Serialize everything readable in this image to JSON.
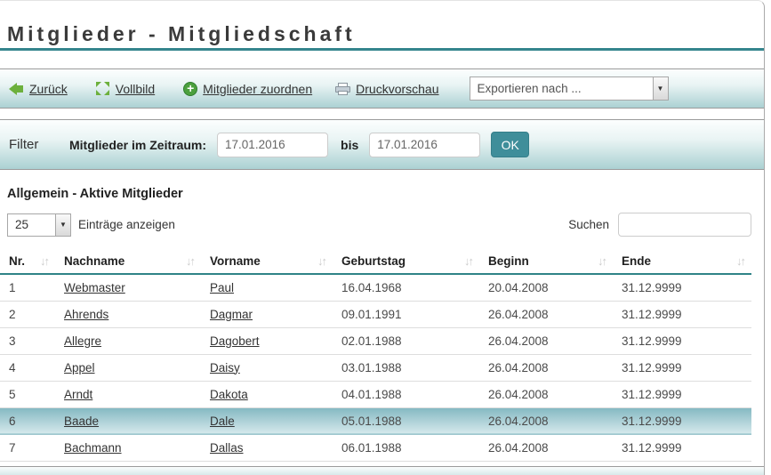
{
  "page": {
    "title": "Mitglieder - Mitgliedschaft"
  },
  "toolbar": {
    "back_label": "Zurück",
    "fullscreen_label": "Vollbild",
    "assign_label": "Mitglieder zuordnen",
    "print_label": "Druckvorschau",
    "export_selected": "Exportieren nach ...",
    "dropdown_arrow": "▼"
  },
  "filter": {
    "label": "Filter",
    "range_label": "Mitglieder im Zeitraum:",
    "date_from": "17.01.2016",
    "bis_label": "bis",
    "date_to": "17.01.2016",
    "ok_label": "OK"
  },
  "section": {
    "heading": "Allgemein - Aktive Mitglieder"
  },
  "table_controls": {
    "page_size": "25",
    "entries_label": "Einträge anzeigen",
    "search_label": "Suchen",
    "search_value": ""
  },
  "table": {
    "columns": [
      "Nr.",
      "Nachname",
      "Vorname",
      "Geburtstag",
      "Beginn",
      "Ende"
    ],
    "sort_icon": "↓↑",
    "rows": [
      {
        "nr": "1",
        "nachname": "Webmaster",
        "vorname": "Paul",
        "geburtstag": "16.04.1968",
        "beginn": "20.04.2008",
        "ende": "31.12.9999",
        "highlighted": false
      },
      {
        "nr": "2",
        "nachname": "Ahrends",
        "vorname": "Dagmar",
        "geburtstag": "09.01.1991",
        "beginn": "26.04.2008",
        "ende": "31.12.9999",
        "highlighted": false
      },
      {
        "nr": "3",
        "nachname": "Allegre",
        "vorname": "Dagobert",
        "geburtstag": "02.01.1988",
        "beginn": "26.04.2008",
        "ende": "31.12.9999",
        "highlighted": false
      },
      {
        "nr": "4",
        "nachname": "Appel",
        "vorname": "Daisy",
        "geburtstag": "03.01.1988",
        "beginn": "26.04.2008",
        "ende": "31.12.9999",
        "highlighted": false
      },
      {
        "nr": "5",
        "nachname": "Arndt",
        "vorname": "Dakota",
        "geburtstag": "04.01.1988",
        "beginn": "26.04.2008",
        "ende": "31.12.9999",
        "highlighted": false
      },
      {
        "nr": "6",
        "nachname": "Baade",
        "vorname": "Dale",
        "geburtstag": "05.01.1988",
        "beginn": "26.04.2008",
        "ende": "31.12.9999",
        "highlighted": true
      },
      {
        "nr": "7",
        "nachname": "Bachmann",
        "vorname": "Dallas",
        "geburtstag": "06.01.1988",
        "beginn": "26.04.2008",
        "ende": "31.12.9999",
        "highlighted": false
      }
    ]
  },
  "colors": {
    "accent_teal": "#35858d",
    "header_border_teal": "#2f8387",
    "ok_button": "#3f8e9a",
    "band_gradient_bottom": "#abd1d3",
    "highlight_row_top": "#83b9c2",
    "highlight_row_bottom": "#d5e9ec",
    "icon_green": "#6cb03c",
    "plus_circle_green": "#4ca03e"
  }
}
